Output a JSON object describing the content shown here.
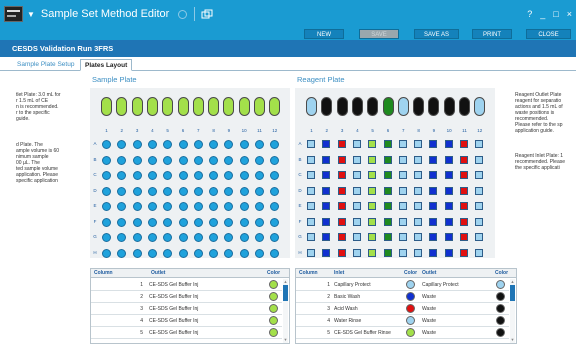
{
  "titlebar": {
    "title": "Sample Set Method Editor",
    "help": "?",
    "minimize": "_",
    "restore": "□",
    "close": "×"
  },
  "actions": {
    "new": "NEW",
    "save": "SAVE",
    "save_as": "SAVE AS",
    "print": "PRINT",
    "close": "CLOSE"
  },
  "run_title": "CESDS Validation Run 3FRS",
  "tabs": {
    "sample_plate_setup": "Sample Plate Setup",
    "plates_layout": "Plates Layout"
  },
  "left_notes": {
    "block1": [
      "tlet Plate: 3.0 mL for",
      "r 1.5 mL of CE",
      "n is recommended.",
      "r to the specific",
      "guide."
    ],
    "block2": [
      "d Plate. The",
      "ample volume is 60",
      "nimum sample",
      "00 µL. The",
      "ted sample volume",
      "application. Please",
      "specific application"
    ]
  },
  "right_notes": {
    "block1": [
      "Reagent Outlet Plate",
      "reagent for separatio",
      "actions and 1.5 mL of",
      "waste positions is",
      "recommended.",
      "Please refer to the sp",
      "application guide."
    ],
    "block2": [
      "Reagent Inlet Plate: 1",
      "recommended. Please",
      "the specific applicati"
    ]
  },
  "sample_plate": {
    "title": "Sample Plate",
    "columns": [
      "1",
      "2",
      "3",
      "4",
      "5",
      "6",
      "7",
      "8",
      "9",
      "10",
      "11",
      "12"
    ],
    "rows": [
      "A",
      "B",
      "C",
      "D",
      "E",
      "F",
      "G",
      "H"
    ],
    "tube_colors": [
      "#a3e04a",
      "#a3e04a",
      "#a3e04a",
      "#a3e04a",
      "#a3e04a",
      "#a3e04a",
      "#a3e04a",
      "#a3e04a",
      "#a3e04a",
      "#a3e04a",
      "#a3e04a",
      "#a3e04a"
    ],
    "well_color": "#1fa2dc"
  },
  "reagent_plate": {
    "title": "Reagent Plate",
    "columns": [
      "1",
      "2",
      "3",
      "4",
      "5",
      "6",
      "7",
      "8",
      "9",
      "10",
      "11",
      "12"
    ],
    "rows": [
      "A",
      "B",
      "C",
      "D",
      "E",
      "F",
      "G",
      "H"
    ],
    "tube_colors": [
      "#9fd3ef",
      "#111111",
      "#111111",
      "#111111",
      "#111111",
      "#1f8a1f",
      "#9fd3ef",
      "#111111",
      "#111111",
      "#111111",
      "#111111",
      "#9fd3ef"
    ],
    "square_colors": [
      "#9fd3ef",
      "#1030d0",
      "#e01010",
      "#9fd3ef",
      "#a3e04a",
      "#1f8a1f",
      "#9fd3ef",
      "#9fd3ef",
      "#1030d0",
      "#1030d0",
      "#e01010",
      "#9fd3ef"
    ]
  },
  "sample_table": {
    "headers": {
      "column": "Column",
      "outlet": "Outlet",
      "color": "Color"
    },
    "rows": [
      {
        "column": "1",
        "outlet": "CE-SDS Gel Buffer Inj",
        "color": "#a3e04a"
      },
      {
        "column": "2",
        "outlet": "CE-SDS Gel Buffer Inj",
        "color": "#a3e04a"
      },
      {
        "column": "3",
        "outlet": "CE-SDS Gel Buffer Inj",
        "color": "#a3e04a"
      },
      {
        "column": "4",
        "outlet": "CE-SDS Gel Buffer Inj",
        "color": "#a3e04a"
      },
      {
        "column": "5",
        "outlet": "CE-SDS Gel Buffer Inj",
        "color": "#a3e04a"
      }
    ]
  },
  "reagent_table": {
    "headers": {
      "column": "Column",
      "inlet": "Inlet",
      "color": "Color",
      "outlet": "Outlet",
      "color2": "Color"
    },
    "rows": [
      {
        "column": "1",
        "inlet": "Capillary Protect",
        "inlet_color": "#9fd3ef",
        "outlet": "Capillary Protect",
        "outlet_color": "#9fd3ef"
      },
      {
        "column": "2",
        "inlet": "Basic Wash",
        "inlet_color": "#1030d0",
        "outlet": "Waste",
        "outlet_color": "#111111"
      },
      {
        "column": "3",
        "inlet": "Acid Wash",
        "inlet_color": "#e01010",
        "outlet": "Waste",
        "outlet_color": "#111111"
      },
      {
        "column": "4",
        "inlet": "Water Rinse",
        "inlet_color": "#9fd3ef",
        "outlet": "Waste",
        "outlet_color": "#111111"
      },
      {
        "column": "5",
        "inlet": "CE-SDS Gel Buffer Rinse",
        "inlet_color": "#a3e04a",
        "outlet": "Waste",
        "outlet_color": "#111111"
      }
    ]
  },
  "accent_color": "#1a9bd2"
}
